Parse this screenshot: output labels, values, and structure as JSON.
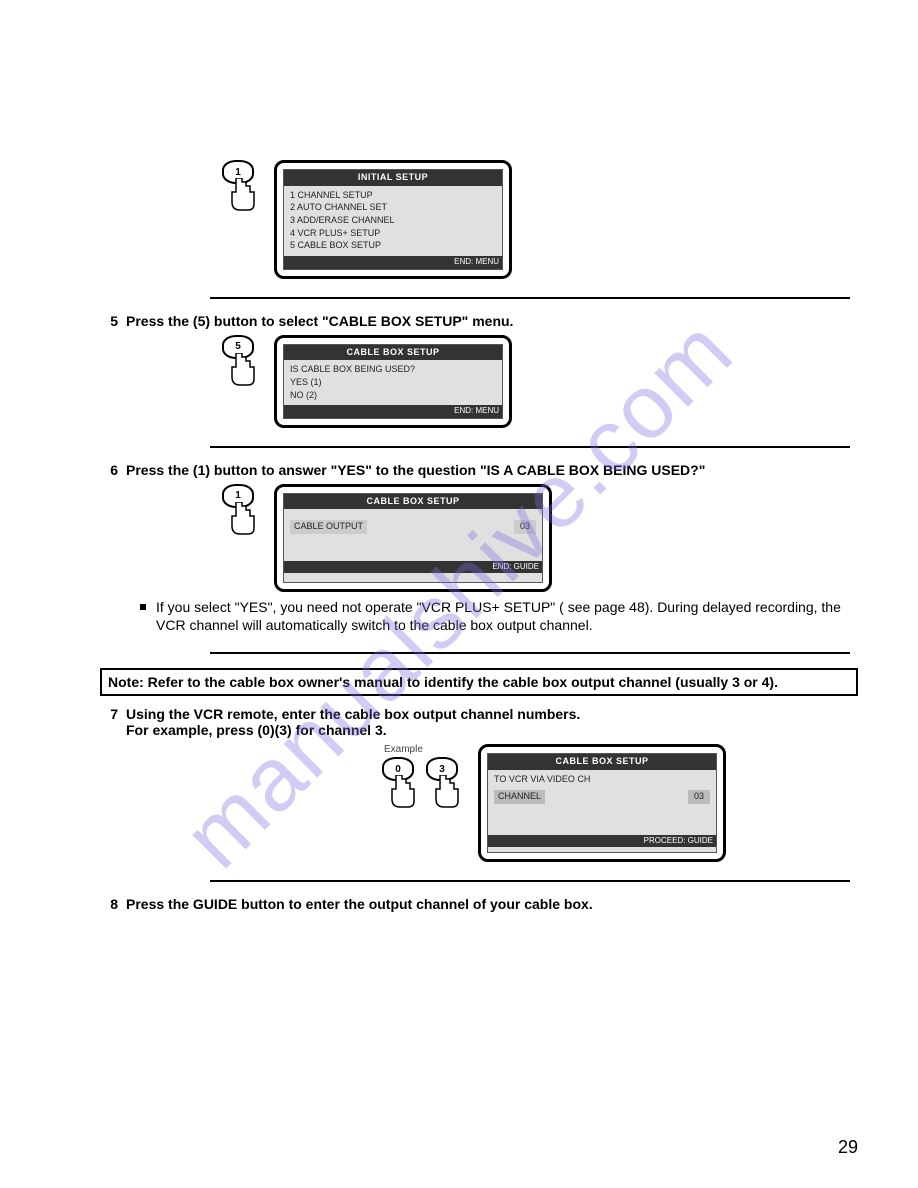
{
  "watermark": "manualshive.com",
  "page_number": "29",
  "figure1": {
    "button_label": "1",
    "title": "INITIAL SETUP",
    "lines": [
      "1  CHANNEL SETUP",
      "2  AUTO CHANNEL SET",
      "3  ADD/ERASE CHANNEL",
      "4  VCR PLUS+ SETUP",
      "5  CABLE BOX SETUP"
    ],
    "footer": "END: MENU"
  },
  "step5": {
    "num": "5",
    "text": "Press the (5) button to select \"CABLE BOX SETUP\" menu."
  },
  "figure5": {
    "button_label": "5",
    "title": "CABLE BOX SETUP",
    "lines": [
      "IS CABLE BOX BEING USED?",
      "YES (1)",
      "NO (2)"
    ],
    "footer": "END: MENU"
  },
  "step6": {
    "num": "6",
    "text": "Press the (1) button to answer \"YES\" to the question \"IS A CABLE BOX BEING USED?\""
  },
  "figure6": {
    "button_label": "1",
    "title": "CABLE BOX SETUP",
    "lines": [
      "CABLE OUTPUT",
      "03"
    ],
    "footer": "END: GUIDE"
  },
  "step6_sub": "If you select \"YES\", you need not operate \"VCR PLUS+ SETUP\" ( see page 48). During delayed recording, the VCR channel will automatically switch to the cable box output channel.",
  "note": "Note: Refer to the cable box owner's manual to identify the cable box output channel (usually 3 or 4).",
  "step7": {
    "num": "7",
    "text": "Using the VCR remote, enter the cable box output channel numbers.",
    "text2": "For example, press (0)(3) for channel 3."
  },
  "figure7": {
    "example_label": "Example",
    "button_labels": [
      "0",
      "3"
    ],
    "title": "CABLE BOX SETUP",
    "lines": [
      "TO VCR VIA VIDEO CH",
      "CHANNEL",
      "03"
    ],
    "footer": "PROCEED: GUIDE"
  },
  "step8": {
    "num": "8",
    "text": "Press the GUIDE button to enter the output channel of your cable box."
  }
}
